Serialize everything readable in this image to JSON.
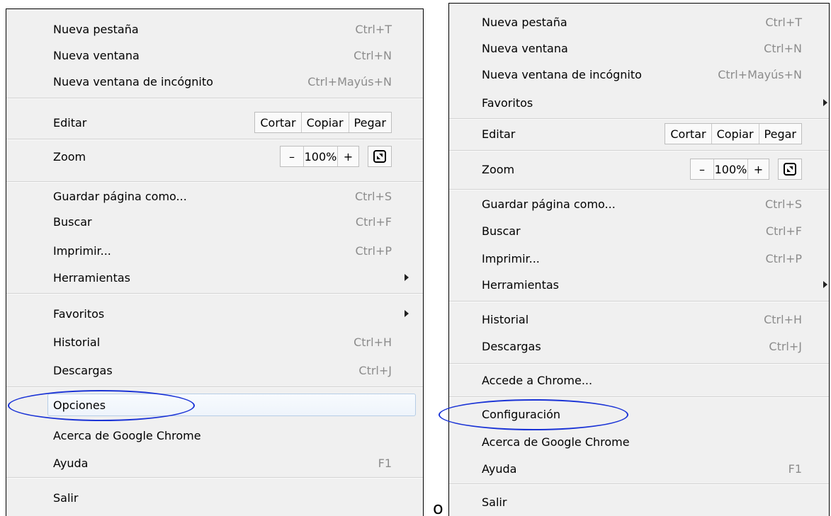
{
  "left_menu": {
    "items": [
      {
        "label": "Nueva pestaña",
        "shortcut": "Ctrl+T"
      },
      {
        "label": "Nueva ventana",
        "shortcut": "Ctrl+N"
      },
      {
        "label": "Nueva ventana de incógnito",
        "shortcut": "Ctrl+Mayús+N"
      }
    ],
    "edit": {
      "label": "Editar",
      "cut": "Cortar",
      "copy": "Copiar",
      "paste": "Pegar"
    },
    "zoom": {
      "label": "Zoom",
      "minus": "–",
      "level": "100%",
      "plus": "+"
    },
    "items2": [
      {
        "label": "Guardar página como...",
        "shortcut": "Ctrl+S"
      },
      {
        "label": "Buscar",
        "shortcut": "Ctrl+F"
      },
      {
        "label": "Imprimir...",
        "shortcut": "Ctrl+P"
      },
      {
        "label": "Herramientas",
        "shortcut": ""
      }
    ],
    "items3": [
      {
        "label": "Favoritos",
        "shortcut": ""
      },
      {
        "label": "Historial",
        "shortcut": "Ctrl+H"
      },
      {
        "label": "Descargas",
        "shortcut": "Ctrl+J"
      }
    ],
    "items4": [
      {
        "label": "Opciones",
        "shortcut": ""
      },
      {
        "label": "Acerca de Google Chrome",
        "shortcut": ""
      },
      {
        "label": "Ayuda",
        "shortcut": "F1"
      }
    ],
    "exit": "Salir"
  },
  "right_menu": {
    "items": [
      {
        "label": "Nueva pestaña",
        "shortcut": "Ctrl+T"
      },
      {
        "label": "Nueva ventana",
        "shortcut": "Ctrl+N"
      },
      {
        "label": "Nueva ventana de incógnito",
        "shortcut": "Ctrl+Mayús+N"
      },
      {
        "label": "Favoritos",
        "shortcut": ""
      }
    ],
    "edit": {
      "label": "Editar",
      "cut": "Cortar",
      "copy": "Copiar",
      "paste": "Pegar"
    },
    "zoom": {
      "label": "Zoom",
      "minus": "–",
      "level": "100%",
      "plus": "+"
    },
    "items2": [
      {
        "label": "Guardar página como...",
        "shortcut": "Ctrl+S"
      },
      {
        "label": "Buscar",
        "shortcut": "Ctrl+F"
      },
      {
        "label": "Imprimir...",
        "shortcut": "Ctrl+P"
      },
      {
        "label": "Herramientas",
        "shortcut": ""
      }
    ],
    "items3": [
      {
        "label": "Historial",
        "shortcut": "Ctrl+H"
      },
      {
        "label": "Descargas",
        "shortcut": "Ctrl+J"
      }
    ],
    "signin": "Accede a Chrome...",
    "items4": [
      {
        "label": "Configuración",
        "shortcut": ""
      },
      {
        "label": "Acerca de Google Chrome",
        "shortcut": ""
      },
      {
        "label": "Ayuda",
        "shortcut": "F1"
      }
    ],
    "exit": "Salir"
  },
  "between_text": "o",
  "colors": {
    "annotation": "#1a33d6",
    "menu_bg": "#f0f0f0",
    "shortcut": "#8c8c8c",
    "hover_border": "#b6cde6"
  }
}
